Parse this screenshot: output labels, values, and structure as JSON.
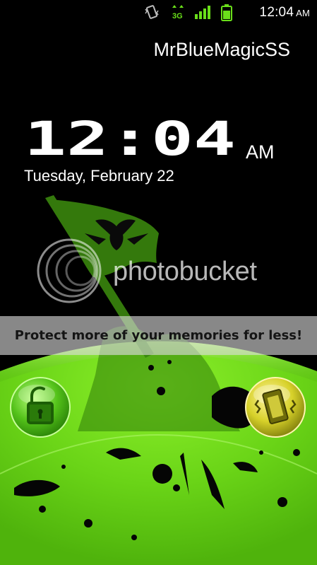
{
  "status_bar": {
    "time": "12:04",
    "ampm": "AM",
    "network_label": "3G",
    "icons": [
      "vibrate-icon",
      "3g-data-icon",
      "signal-icon",
      "battery-icon"
    ],
    "accent_color": "#6adf1a"
  },
  "lockscreen": {
    "operator_name": "MrBlueMagicSS",
    "clock_time": "12:04",
    "clock_ampm": "AM",
    "date": "Tuesday, February 22",
    "unlock_icon": "unlock-icon",
    "sound_toggle_icon": "vibrate-phone-icon",
    "theme_color": "#77e51f"
  },
  "watermark": {
    "brand": "photobucket",
    "banner": "Protect more of your memories for less!"
  }
}
